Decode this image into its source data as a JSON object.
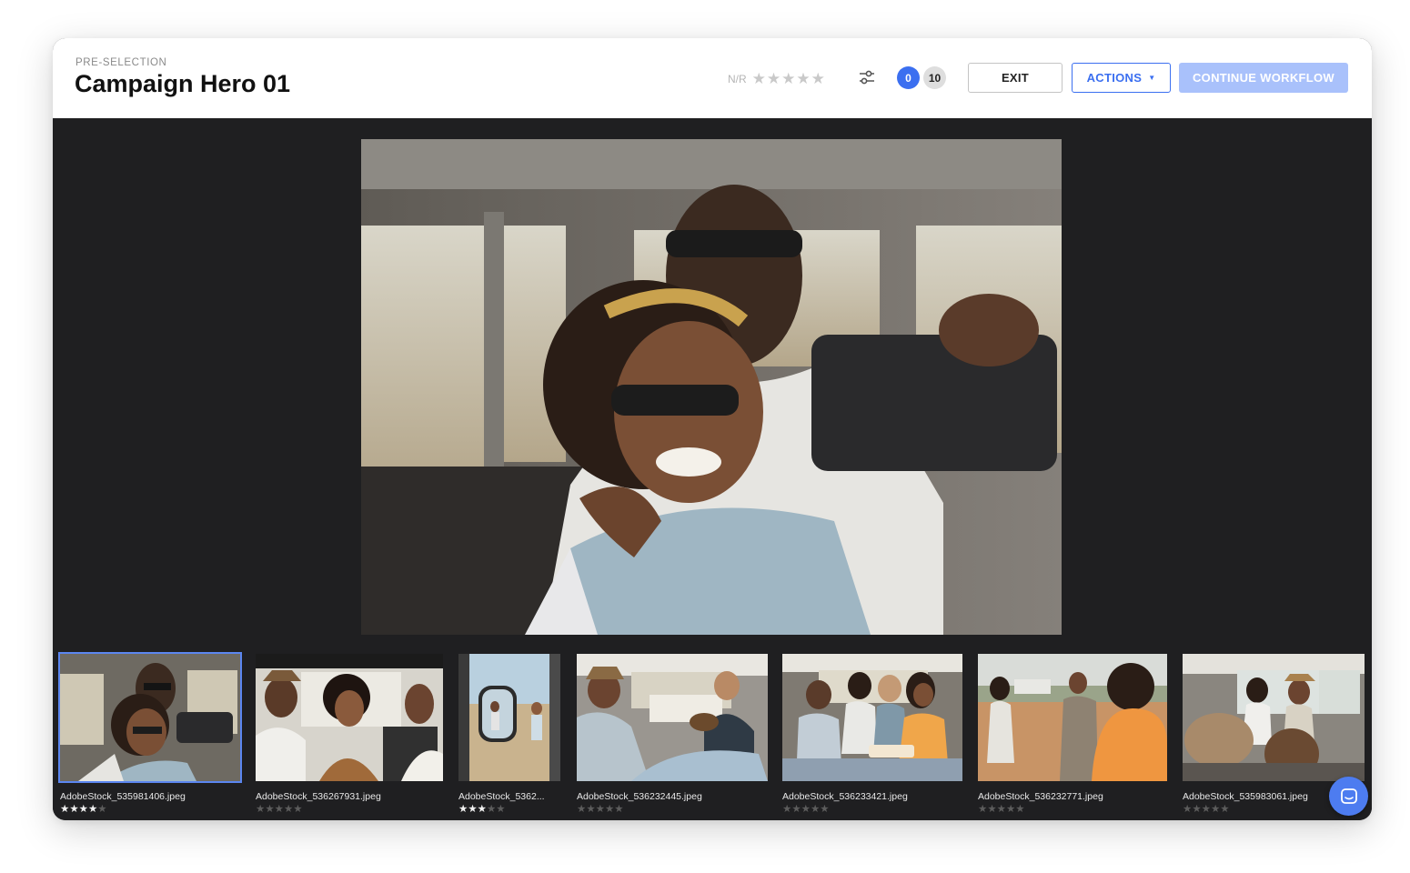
{
  "header": {
    "eyebrow": "PRE-SELECTION",
    "title": "Campaign Hero 01",
    "rating_label": "N/R",
    "rating_value": 0,
    "filter_icon": "sliders-icon",
    "count_selected": "0",
    "count_total": "10",
    "exit_label": "EXIT",
    "actions_label": "ACTIONS",
    "continue_label": "CONTINUE WORKFLOW"
  },
  "colors": {
    "accent": "#3b6ff0",
    "continue_disabled": "#a9c1fb",
    "viewer_bg": "#1f1f21"
  },
  "viewer": {
    "main_image": "couple-selfie-in-vehicle"
  },
  "filmstrip": {
    "items": [
      {
        "name": "AdobeStock_535981406.jpeg",
        "rating": 4,
        "selected": true
      },
      {
        "name": "AdobeStock_536267931.jpeg",
        "rating": 0,
        "selected": false
      },
      {
        "name": "AdobeStock_5362...",
        "rating": 3,
        "selected": false
      },
      {
        "name": "AdobeStock_536232445.jpeg",
        "rating": 0,
        "selected": false
      },
      {
        "name": "AdobeStock_536233421.jpeg",
        "rating": 0,
        "selected": false
      },
      {
        "name": "AdobeStock_536232771.jpeg",
        "rating": 0,
        "selected": false
      },
      {
        "name": "AdobeStock_535983061.jpeg",
        "rating": 0,
        "selected": false
      }
    ]
  },
  "chat_icon": "chat-bubble-icon"
}
